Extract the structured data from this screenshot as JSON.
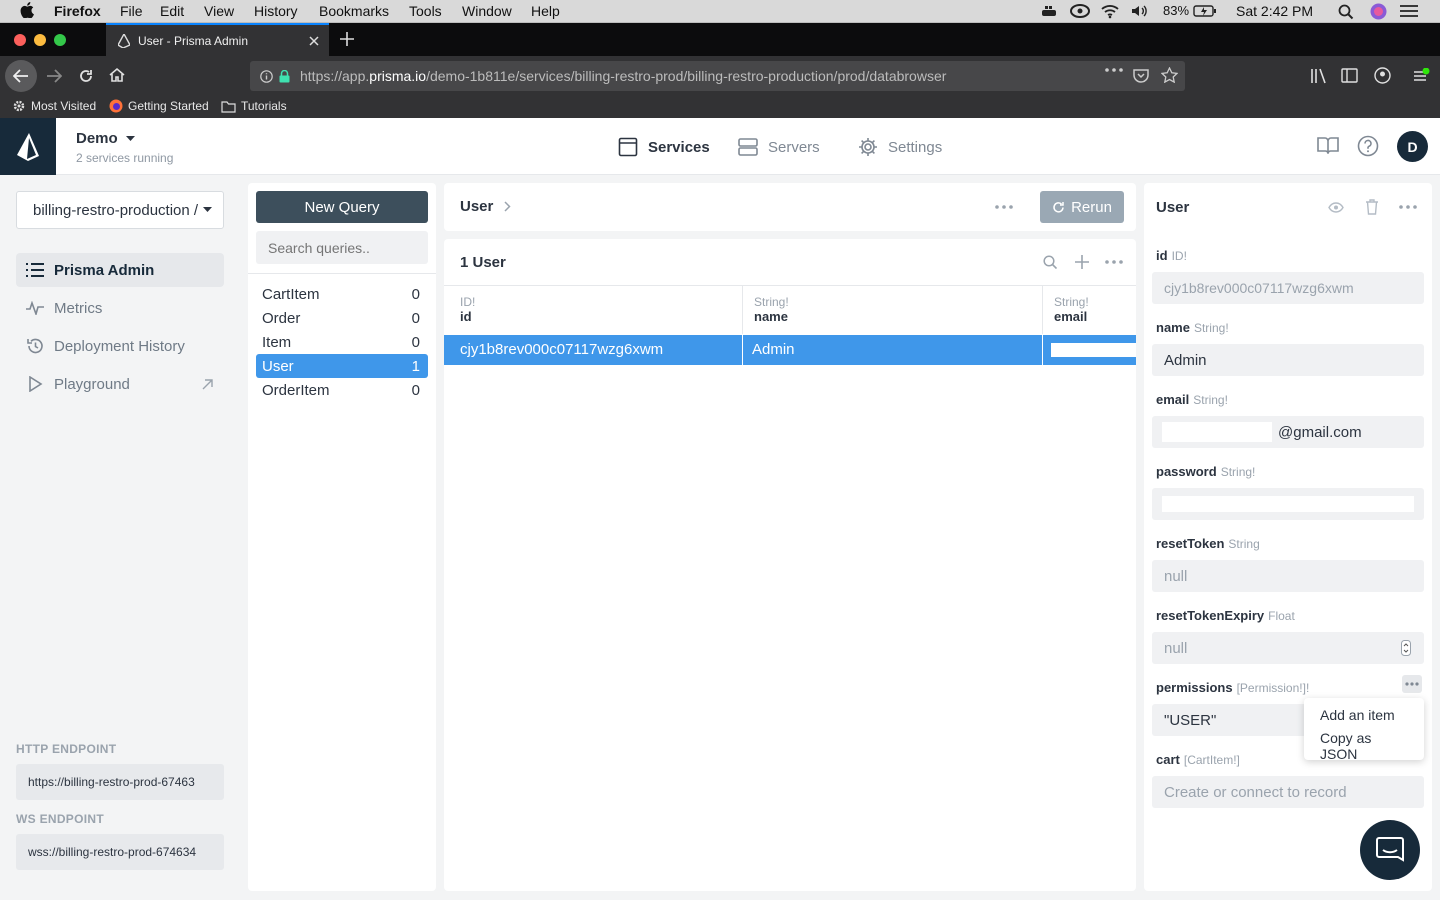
{
  "menubar": {
    "app_name": "Firefox",
    "items": [
      "File",
      "Edit",
      "View",
      "History",
      "Bookmarks",
      "Tools",
      "Window",
      "Help"
    ],
    "battery": "83%",
    "clock": "Sat 2:42 PM"
  },
  "browser": {
    "tab_title": "User - Prisma Admin",
    "url_prefix": "https://app.",
    "url_domain": "prisma.io",
    "url_rest": "/demo-1b811e/services/billing-restro-prod/billing-restro-production/prod/databrowser",
    "bookmarks": [
      "Most Visited",
      "Getting Started",
      "Tutorials"
    ]
  },
  "header": {
    "workspace": "Demo",
    "services_running": "2 services running",
    "nav": [
      "Services",
      "Servers",
      "Settings"
    ],
    "avatar_initial": "D"
  },
  "sidebar": {
    "service_select": "billing-restro-production /",
    "items": [
      "Prisma Admin",
      "Metrics",
      "Deployment History",
      "Playground"
    ],
    "http_label": "HTTP ENDPOINT",
    "http_value": "https://billing-restro-prod-67463",
    "ws_label": "WS ENDPOINT",
    "ws_value": "wss://billing-restro-prod-674634"
  },
  "queries": {
    "new_query": "New Query",
    "search_placeholder": "Search queries..",
    "models": [
      {
        "name": "CartItem",
        "count": "0"
      },
      {
        "name": "Order",
        "count": "0"
      },
      {
        "name": "Item",
        "count": "0"
      },
      {
        "name": "User",
        "count": "1"
      },
      {
        "name": "OrderItem",
        "count": "0"
      }
    ]
  },
  "main": {
    "breadcrumb": "User",
    "rerun": "Rerun",
    "result_count": "1 User",
    "columns": [
      {
        "type": "ID!",
        "name": "id"
      },
      {
        "type": "String!",
        "name": "name"
      },
      {
        "type": "String!",
        "name": "email"
      }
    ],
    "row": {
      "id": "cjy1b8rev000c07117wzg6xwm",
      "name": "Admin"
    }
  },
  "detail": {
    "title": "User",
    "fields": [
      {
        "name": "id",
        "type": "ID!",
        "value": "cjy1b8rev000c07117wzg6xwm"
      },
      {
        "name": "name",
        "type": "String!",
        "value": "Admin"
      },
      {
        "name": "email",
        "type": "String!",
        "value": "@gmail.com"
      },
      {
        "name": "password",
        "type": "String!",
        "value": ""
      },
      {
        "name": "resetToken",
        "type": "String",
        "value": "null"
      },
      {
        "name": "resetTokenExpiry",
        "type": "Float",
        "value": "null"
      },
      {
        "name": "permissions",
        "type": "[Permission!]!",
        "value": "\"USER\""
      },
      {
        "name": "cart",
        "type": "[CartItem!]",
        "value": "Create or connect to record"
      }
    ],
    "menu": [
      "Add an item",
      "Copy as JSON"
    ]
  }
}
